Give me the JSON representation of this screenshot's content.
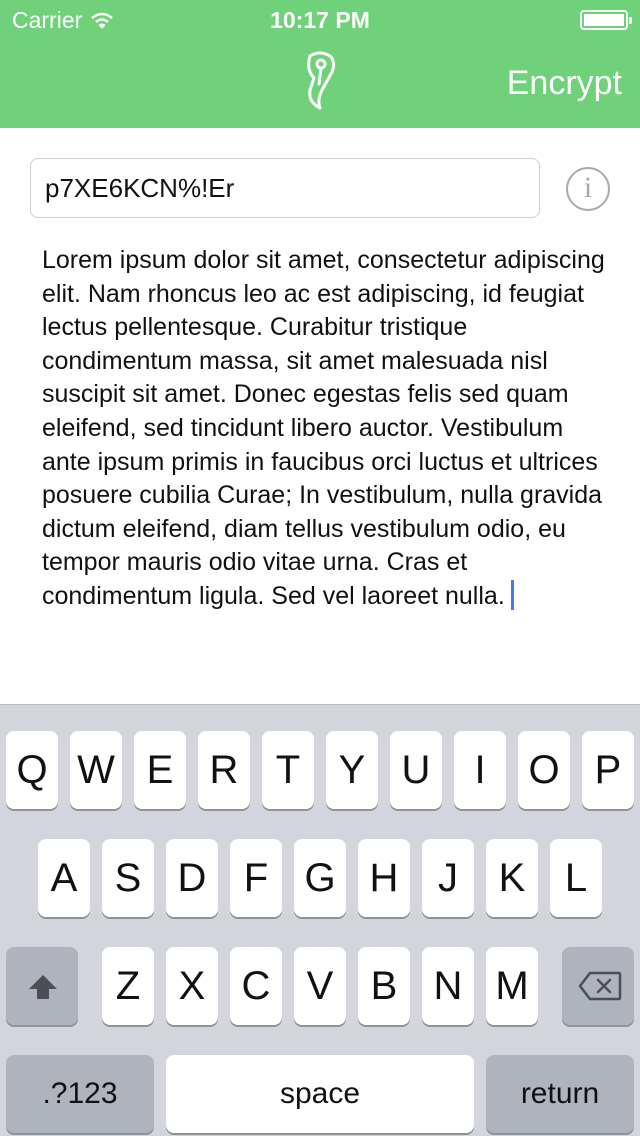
{
  "status_bar": {
    "carrier": "Carrier",
    "time": "10:17 PM"
  },
  "nav": {
    "action_label": "Encrypt",
    "logo_icon": "pen-nib-logo-icon",
    "accent_color": "#6fd27a"
  },
  "form": {
    "key_value": "p7XE6KCN%!Er",
    "info_icon": "i",
    "message": "Lorem ipsum dolor sit amet, consectetur adipiscing elit. Nam rhoncus leo ac est adipiscing, id feugiat lectus pellentesque. Curabitur tristique condimentum massa, sit amet malesuada nisl suscipit sit amet. Donec egestas felis sed quam eleifend, sed tincidunt libero auctor. Vestibulum ante ipsum primis in faucibus orci luctus et ultrices posuere cubilia Curae; In vestibulum, nulla gravida dictum eleifend, diam tellus vestibulum odio, eu tempor mauris odio vitae urna. Cras et condimentum ligula. Sed vel laoreet nulla."
  },
  "keyboard": {
    "row1": [
      "Q",
      "W",
      "E",
      "R",
      "T",
      "Y",
      "U",
      "I",
      "O",
      "P"
    ],
    "row2": [
      "A",
      "S",
      "D",
      "F",
      "G",
      "H",
      "J",
      "K",
      "L"
    ],
    "row3": [
      "Z",
      "X",
      "C",
      "V",
      "B",
      "N",
      "M"
    ],
    "numbers_label": ".?123",
    "space_label": "space",
    "return_label": "return"
  }
}
